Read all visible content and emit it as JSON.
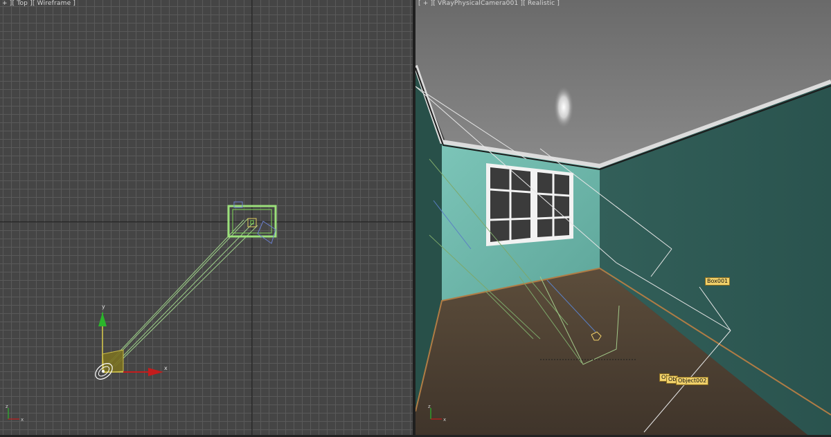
{
  "viewports": {
    "left": {
      "label": "+ ][ Top ][ Wireframe ]",
      "axis_x": "x",
      "axis_y": "y",
      "mini_axis_x": "x",
      "mini_axis_y": "z"
    },
    "right": {
      "label": "[ + ][ VRayPhysicalCamera001 ][ Realistic ]",
      "tags": {
        "box": "Box001",
        "obj_a": "Ol",
        "obj_b": "Ob",
        "obj_c": "Object002"
      },
      "mini_axis_x": "x",
      "mini_axis_y": "z"
    }
  },
  "colors": {
    "grid_bg": "#454545",
    "grid_line": "#5a5a5a",
    "selection": "#7ed957",
    "wall": "#2e5a55",
    "window_wall": "#6fb7ab",
    "floor": "#4e4132",
    "ceiling": "#7d7d7d"
  }
}
